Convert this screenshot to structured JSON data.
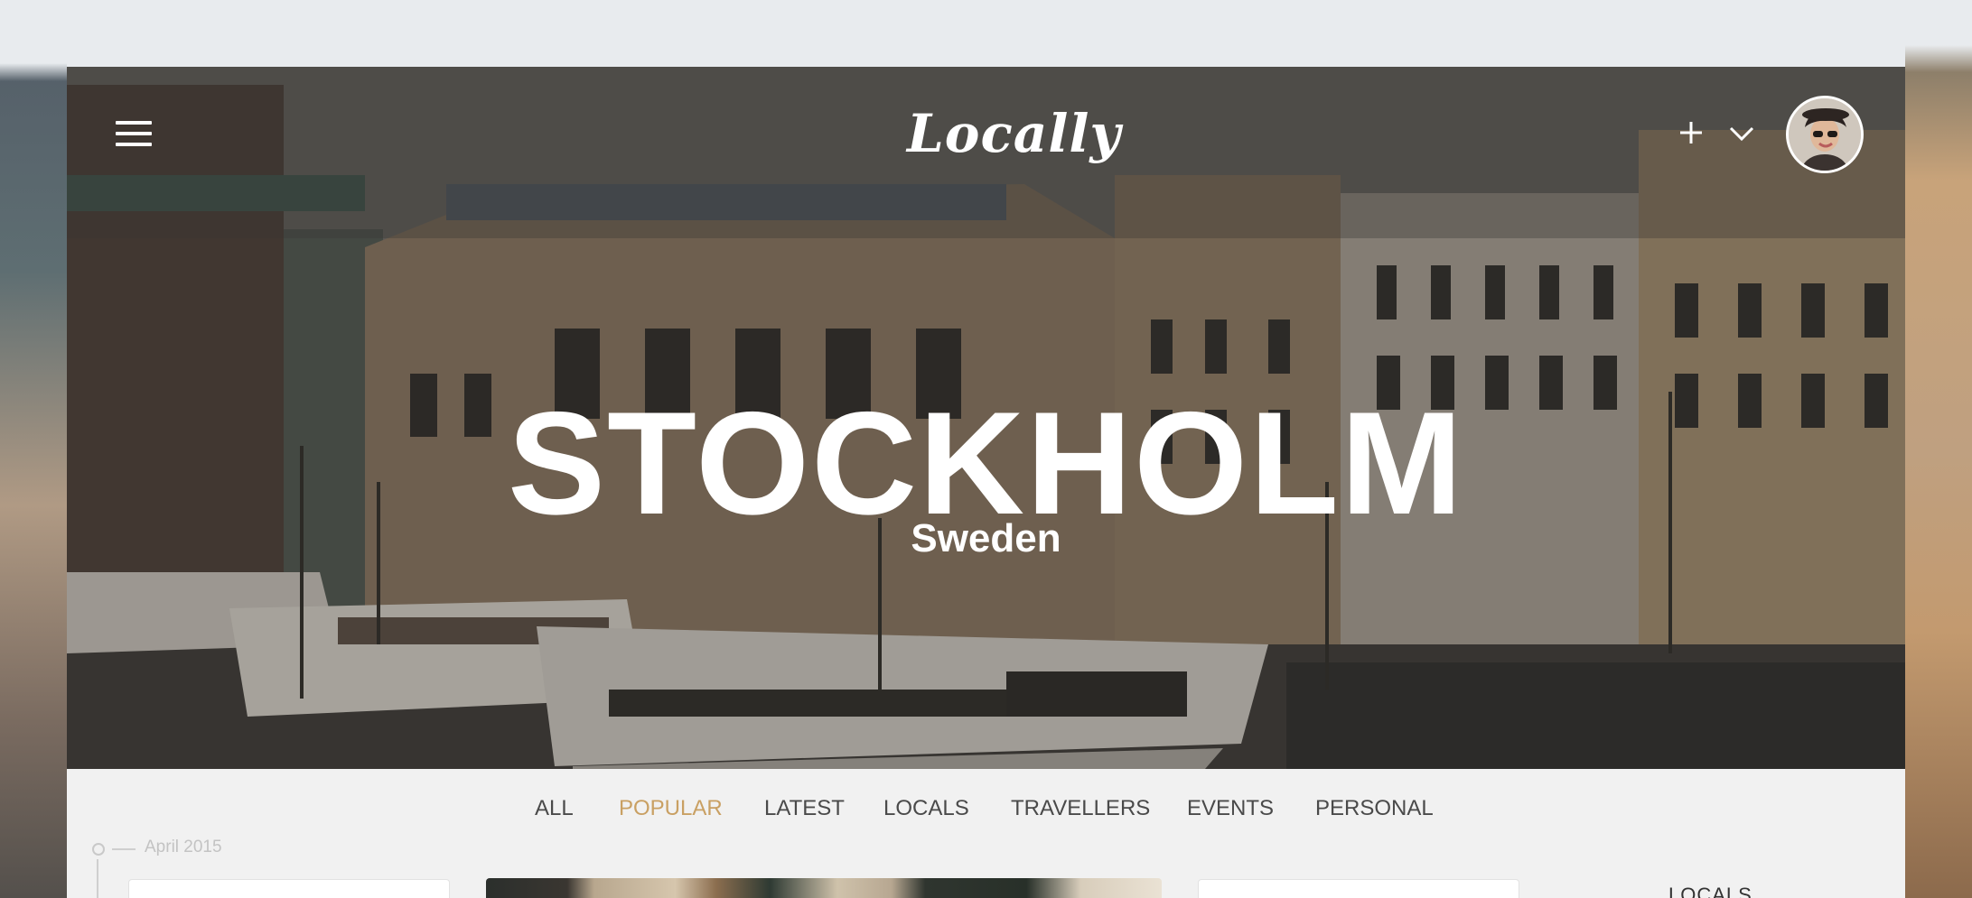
{
  "header": {
    "logo_text": "Locally",
    "menu_icon": "hamburger-icon",
    "add_icon": "plus-icon",
    "dropdown_icon": "chevron-down-icon"
  },
  "hero": {
    "city": "STOCKHOLM",
    "country": "Sweden"
  },
  "tabs": [
    {
      "label": "ALL",
      "active": false
    },
    {
      "label": "POPULAR",
      "active": true
    },
    {
      "label": "LATEST",
      "active": false
    },
    {
      "label": "LOCALS",
      "active": false
    },
    {
      "label": "TRAVELLERS",
      "active": false
    },
    {
      "label": "EVENTS",
      "active": false
    },
    {
      "label": "PERSONAL",
      "active": false
    }
  ],
  "timeline": {
    "date": "April 2015"
  },
  "sidebar": {
    "heading": "LOCALS"
  },
  "colors": {
    "accent": "#c9a063",
    "tab_text": "#4a4a4a",
    "page_bg": "#f1f1f1"
  }
}
